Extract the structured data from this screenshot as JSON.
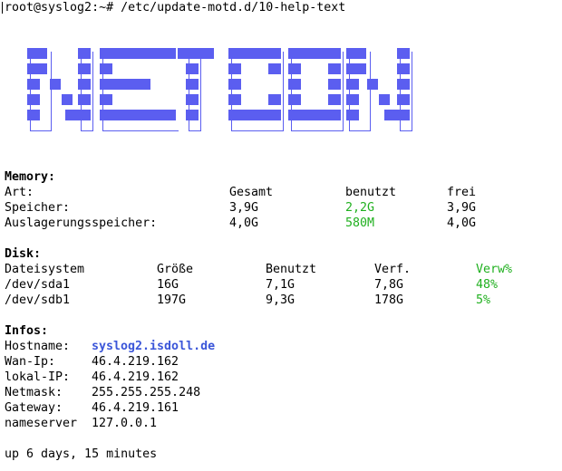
{
  "prompt_line": "root@syslog2:~# /etc/update-motd.d/10-help-text",
  "logo": {
    "text": "NETCON"
  },
  "colors": {
    "logo": "#5b5ef0",
    "used": "#20b01f",
    "hostname": "#3b56d9"
  },
  "memory": {
    "title": "Memory:",
    "headers": [
      "Art:",
      "Gesamt",
      "benutzt",
      "frei"
    ],
    "rows": [
      [
        "Speicher:",
        "3,9G",
        "2,2G",
        "3,9G"
      ],
      [
        "Auslagerungsspeicher:",
        "4,0G",
        "580M",
        "4,0G"
      ]
    ]
  },
  "disk": {
    "title": "Disk:",
    "headers": [
      "Dateisystem",
      "Größe",
      "Benutzt",
      "Verf.",
      "Verw%"
    ],
    "rows": [
      [
        "/dev/sda1",
        "16G",
        "7,1G",
        "7,8G",
        "48%"
      ],
      [
        "/dev/sdb1",
        "197G",
        "9,3G",
        "178G",
        "5%"
      ]
    ]
  },
  "infos": {
    "title": "Infos:",
    "rows": [
      [
        "Hostname:",
        "syslog2.isdoll.de"
      ],
      [
        "Wan-Ip:",
        "46.4.219.162"
      ],
      [
        "lokal-IP:",
        "46.4.219.162"
      ],
      [
        "Netmask:",
        "255.255.255.248"
      ],
      [
        "Gateway:",
        "46.4.219.161"
      ],
      [
        "nameserver",
        "127.0.0.1"
      ]
    ]
  },
  "uptime": "up 6 days, 15 minutes"
}
